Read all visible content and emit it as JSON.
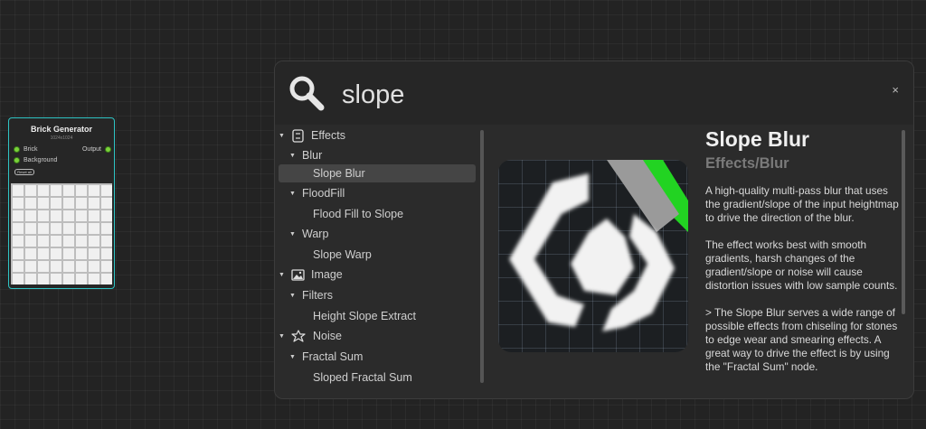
{
  "node": {
    "title": "Brick Generator",
    "subtitle": "1024x1024",
    "input_1": "Brick",
    "input_2": "Background",
    "output": "Output",
    "reset_label": "Reset all"
  },
  "search": {
    "query": "slope",
    "close_label": "×"
  },
  "results": [
    {
      "type": "category",
      "label": "Effects",
      "icon": "effects-icon"
    },
    {
      "type": "group",
      "label": "Blur"
    },
    {
      "type": "leaf",
      "label": "Slope Blur",
      "selected": true
    },
    {
      "type": "group",
      "label": "FloodFill"
    },
    {
      "type": "leaf",
      "label": "Flood Fill to Slope"
    },
    {
      "type": "group",
      "label": "Warp"
    },
    {
      "type": "leaf",
      "label": "Slope Warp"
    },
    {
      "type": "category",
      "label": "Image",
      "icon": "image-icon"
    },
    {
      "type": "group",
      "label": "Filters"
    },
    {
      "type": "leaf",
      "label": "Height Slope Extract"
    },
    {
      "type": "category",
      "label": "Noise",
      "icon": "noise-icon"
    },
    {
      "type": "group",
      "label": "Fractal Sum"
    },
    {
      "type": "leaf",
      "label": "Sloped Fractal Sum"
    }
  ],
  "detail": {
    "title": "Slope Blur",
    "path": "Effects/Blur",
    "paragraphs": [
      "A high-quality multi-pass blur that uses the gradient/slope of the input heightmap to drive the direction of the blur.",
      "The effect works best with smooth gradients, harsh changes of the gradient/slope or noise will cause distortion issues with low sample counts.",
      "> The Slope Blur serves a wide range of possible effects from chiseling for stones to edge wear and smearing effects. A great way to drive the effect is by using the \"Fractal Sum\" node."
    ]
  },
  "colors": {
    "accent_node_border": "#2ec4c4",
    "pin_green": "#7ad33a",
    "preview_stripe": "#22d322"
  }
}
